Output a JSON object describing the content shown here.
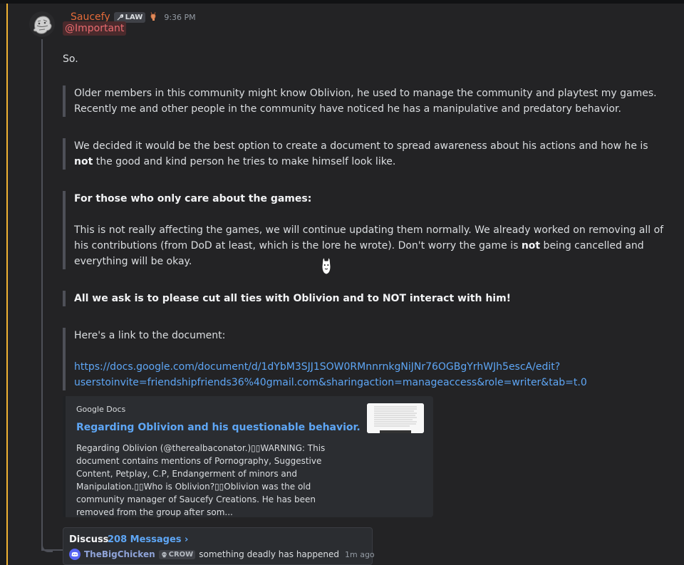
{
  "message": {
    "author": "Saucefy",
    "role_tag": "LAW",
    "timestamp": "9:36 PM",
    "mention": "@Important",
    "intro": "So.",
    "para1": "Older members in this community might know Oblivion, he used to manage the community and playtest my games. Recently me and other people in the community have noticed he has a manipulative and predatory behavior.",
    "para2_a": "We decided it would be the best option to create a document to spread awareness about his actions and how he is ",
    "para2_b": "not",
    "para2_c": " the good and kind person he tries to make himself look like.",
    "para3_heading": "For those who only care about the games:",
    "para3_a": "This is not really affecting the games, we will continue updating them normally. We already worked on removing all of his contributions (from DoD at least, which is the lore he wrote). Don't worry the game is ",
    "para3_b": "not",
    "para3_c": " being cancelled and everything will be okay.",
    "para4": "All we ask is to please cut all ties with Oblivion and to NOT interact with him!",
    "para5": "Here's a link to the document:",
    "link_line1": "https://docs.google.com/document/d/1dYbM3SJJ1SOW0RMnnrnkgNiJNr76OGBgYrhWJh5escA/edit?",
    "link_line2": "userstoinvite=friendshipfriends36%40gmail.com&sharingaction=manageaccess&role=writer&tab=t.0"
  },
  "embed": {
    "provider": "Google Docs",
    "title": "Regarding Oblivion and his questionable behavior.",
    "description": "Regarding Oblivion (@therealbaconator.)▯▯WARNING: This document contains mentions of Pornography, Suggestive Content, Petplay, C.P, Endangerment of minors and Manipulation.▯▯Who is Oblivion?▯▯Oblivion was the old community manager of Saucefy Creations. He has been removed from the group after som..."
  },
  "thread": {
    "name": "Discuss",
    "count": "208 Messages ›",
    "last_user": "TheBigChicken",
    "last_role": "CROW",
    "last_message": "something deadly has happened",
    "last_time": "1m ago"
  },
  "colors": {
    "username": "#e46b3a",
    "link": "#5ea6f5",
    "mention_text": "#e86a6f",
    "mention_stripe": "#f0b232"
  },
  "icons": {
    "role_icon": "wrench-icon",
    "role_emoji": "deer-emoji-icon",
    "thread_avatar": "discord-logo-icon",
    "crow_icon": "skull-icon"
  }
}
